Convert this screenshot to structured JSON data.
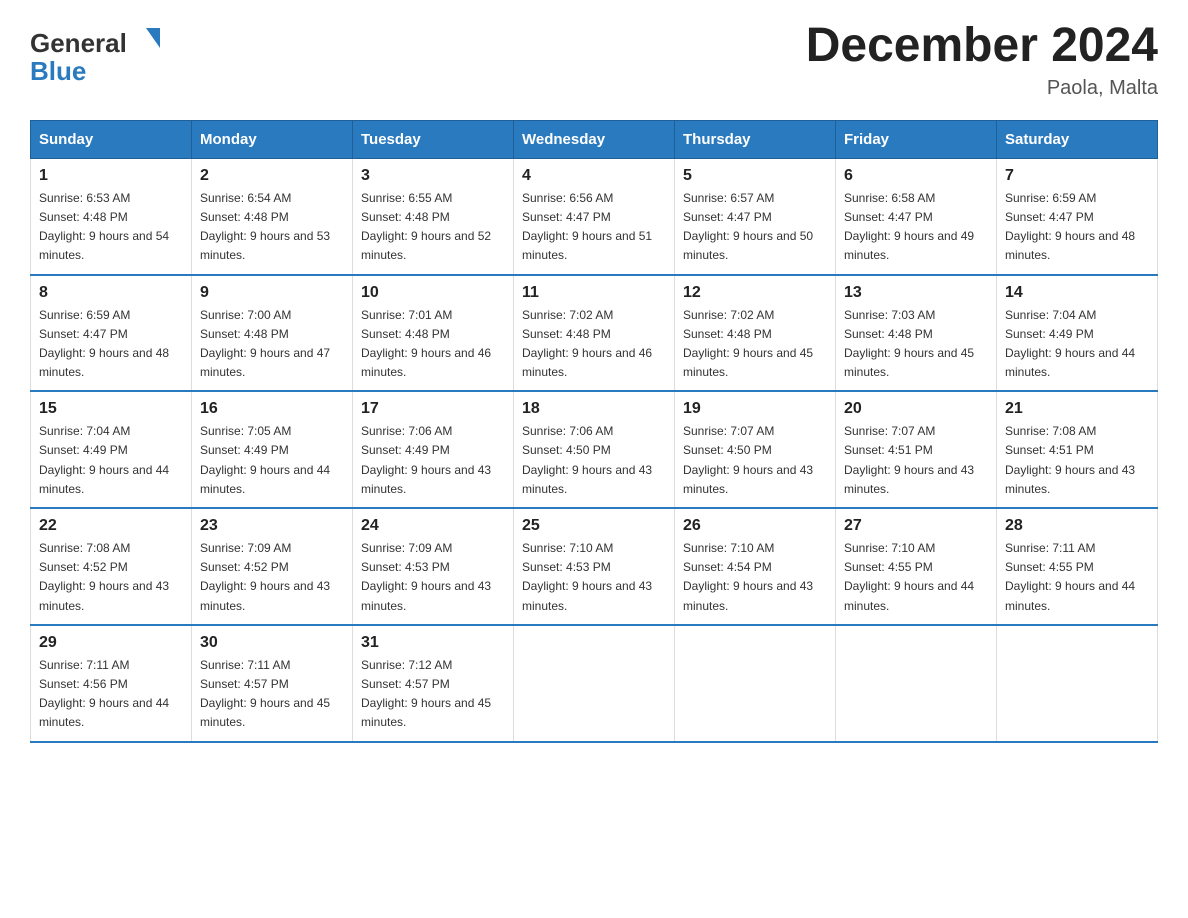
{
  "header": {
    "logo_general": "General",
    "logo_blue": "Blue",
    "title": "December 2024",
    "subtitle": "Paola, Malta"
  },
  "weekdays": [
    "Sunday",
    "Monday",
    "Tuesday",
    "Wednesday",
    "Thursday",
    "Friday",
    "Saturday"
  ],
  "weeks": [
    [
      {
        "day": "1",
        "sunrise": "6:53 AM",
        "sunset": "4:48 PM",
        "daylight": "9 hours and 54 minutes."
      },
      {
        "day": "2",
        "sunrise": "6:54 AM",
        "sunset": "4:48 PM",
        "daylight": "9 hours and 53 minutes."
      },
      {
        "day": "3",
        "sunrise": "6:55 AM",
        "sunset": "4:48 PM",
        "daylight": "9 hours and 52 minutes."
      },
      {
        "day": "4",
        "sunrise": "6:56 AM",
        "sunset": "4:47 PM",
        "daylight": "9 hours and 51 minutes."
      },
      {
        "day": "5",
        "sunrise": "6:57 AM",
        "sunset": "4:47 PM",
        "daylight": "9 hours and 50 minutes."
      },
      {
        "day": "6",
        "sunrise": "6:58 AM",
        "sunset": "4:47 PM",
        "daylight": "9 hours and 49 minutes."
      },
      {
        "day": "7",
        "sunrise": "6:59 AM",
        "sunset": "4:47 PM",
        "daylight": "9 hours and 48 minutes."
      }
    ],
    [
      {
        "day": "8",
        "sunrise": "6:59 AM",
        "sunset": "4:47 PM",
        "daylight": "9 hours and 48 minutes."
      },
      {
        "day": "9",
        "sunrise": "7:00 AM",
        "sunset": "4:48 PM",
        "daylight": "9 hours and 47 minutes."
      },
      {
        "day": "10",
        "sunrise": "7:01 AM",
        "sunset": "4:48 PM",
        "daylight": "9 hours and 46 minutes."
      },
      {
        "day": "11",
        "sunrise": "7:02 AM",
        "sunset": "4:48 PM",
        "daylight": "9 hours and 46 minutes."
      },
      {
        "day": "12",
        "sunrise": "7:02 AM",
        "sunset": "4:48 PM",
        "daylight": "9 hours and 45 minutes."
      },
      {
        "day": "13",
        "sunrise": "7:03 AM",
        "sunset": "4:48 PM",
        "daylight": "9 hours and 45 minutes."
      },
      {
        "day": "14",
        "sunrise": "7:04 AM",
        "sunset": "4:49 PM",
        "daylight": "9 hours and 44 minutes."
      }
    ],
    [
      {
        "day": "15",
        "sunrise": "7:04 AM",
        "sunset": "4:49 PM",
        "daylight": "9 hours and 44 minutes."
      },
      {
        "day": "16",
        "sunrise": "7:05 AM",
        "sunset": "4:49 PM",
        "daylight": "9 hours and 44 minutes."
      },
      {
        "day": "17",
        "sunrise": "7:06 AM",
        "sunset": "4:49 PM",
        "daylight": "9 hours and 43 minutes."
      },
      {
        "day": "18",
        "sunrise": "7:06 AM",
        "sunset": "4:50 PM",
        "daylight": "9 hours and 43 minutes."
      },
      {
        "day": "19",
        "sunrise": "7:07 AM",
        "sunset": "4:50 PM",
        "daylight": "9 hours and 43 minutes."
      },
      {
        "day": "20",
        "sunrise": "7:07 AM",
        "sunset": "4:51 PM",
        "daylight": "9 hours and 43 minutes."
      },
      {
        "day": "21",
        "sunrise": "7:08 AM",
        "sunset": "4:51 PM",
        "daylight": "9 hours and 43 minutes."
      }
    ],
    [
      {
        "day": "22",
        "sunrise": "7:08 AM",
        "sunset": "4:52 PM",
        "daylight": "9 hours and 43 minutes."
      },
      {
        "day": "23",
        "sunrise": "7:09 AM",
        "sunset": "4:52 PM",
        "daylight": "9 hours and 43 minutes."
      },
      {
        "day": "24",
        "sunrise": "7:09 AM",
        "sunset": "4:53 PM",
        "daylight": "9 hours and 43 minutes."
      },
      {
        "day": "25",
        "sunrise": "7:10 AM",
        "sunset": "4:53 PM",
        "daylight": "9 hours and 43 minutes."
      },
      {
        "day": "26",
        "sunrise": "7:10 AM",
        "sunset": "4:54 PM",
        "daylight": "9 hours and 43 minutes."
      },
      {
        "day": "27",
        "sunrise": "7:10 AM",
        "sunset": "4:55 PM",
        "daylight": "9 hours and 44 minutes."
      },
      {
        "day": "28",
        "sunrise": "7:11 AM",
        "sunset": "4:55 PM",
        "daylight": "9 hours and 44 minutes."
      }
    ],
    [
      {
        "day": "29",
        "sunrise": "7:11 AM",
        "sunset": "4:56 PM",
        "daylight": "9 hours and 44 minutes."
      },
      {
        "day": "30",
        "sunrise": "7:11 AM",
        "sunset": "4:57 PM",
        "daylight": "9 hours and 45 minutes."
      },
      {
        "day": "31",
        "sunrise": "7:12 AM",
        "sunset": "4:57 PM",
        "daylight": "9 hours and 45 minutes."
      },
      null,
      null,
      null,
      null
    ]
  ]
}
